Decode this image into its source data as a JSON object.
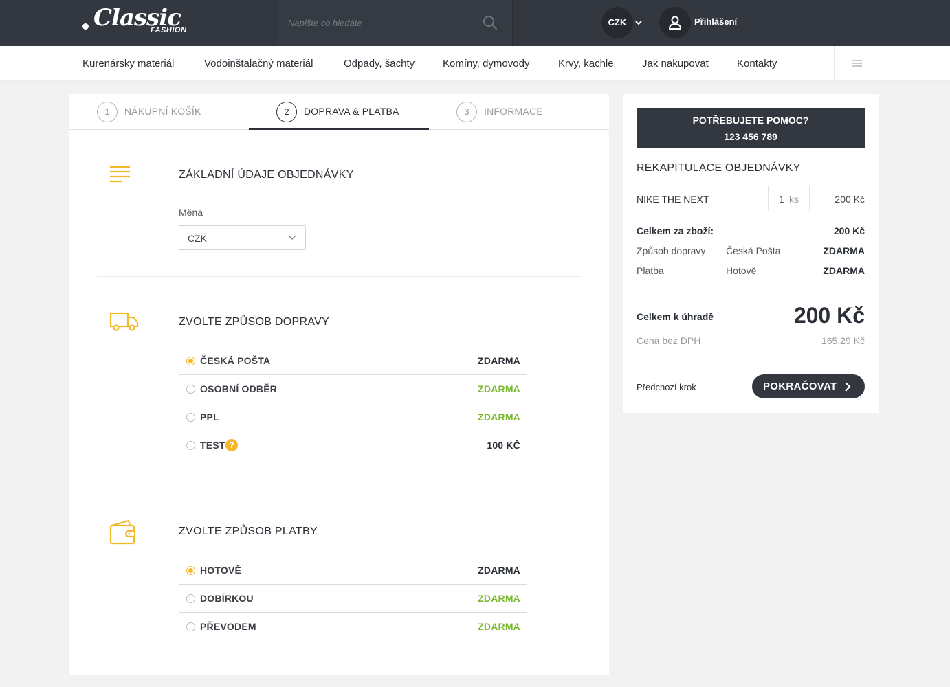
{
  "header": {
    "logo_script": "Classic",
    "logo_sub": "FASHION",
    "search_placeholder": "Napište co hledáte",
    "currency": "CZK",
    "login": "Přihlášení"
  },
  "nav": {
    "items": [
      "Kurenársky materiál",
      "Vodoinštalačný materiál",
      "Odpady, šachty",
      "Komíny, dymovody",
      "Krvy, kachle",
      "Jak nakupovat",
      "Kontakty"
    ]
  },
  "steps": [
    {
      "num": "1",
      "label": "NÁKUPNÍ KOŠÍK"
    },
    {
      "num": "2",
      "label": "DOPRAVA & PLATBA"
    },
    {
      "num": "3",
      "label": "INFORMACE"
    }
  ],
  "basic": {
    "title": "ZÁKLADNÍ ÚDAJE OBJEDNÁVKY",
    "currency_label": "Měna",
    "currency_value": "CZK"
  },
  "shipping": {
    "title": "ZVOLTE ZPŮSOB DOPRAVY",
    "options": [
      {
        "name": "ČESKÁ POŠTA",
        "price": "ZDARMA",
        "selected": true
      },
      {
        "name": "OSOBNÍ ODBĚR",
        "price": "ZDARMA",
        "selected": false
      },
      {
        "name": "PPL",
        "price": "ZDARMA",
        "selected": false
      },
      {
        "name": "TEST",
        "price": "100 KČ",
        "selected": false,
        "help": "?"
      }
    ]
  },
  "payment": {
    "title": "ZVOLTE ZPŮSOB PLATBY",
    "options": [
      {
        "name": "HOTOVĚ",
        "price": "ZDARMA",
        "selected": true
      },
      {
        "name": "DOBÍRKOU",
        "price": "ZDARMA",
        "selected": false
      },
      {
        "name": "PŘEVODEM",
        "price": "ZDARMA",
        "selected": false
      }
    ]
  },
  "sidebar": {
    "help_title": "POTŘEBUJETE POMOC?",
    "help_phone": "123 456 789",
    "recap_title": "REKAPITULACE OBJEDNÁVKY",
    "item": {
      "name": "NIKE THE NEXT",
      "qty": "1",
      "unit": "ks",
      "price": "200 Kč"
    },
    "goods_total_label": "Celkem za zboží:",
    "goods_total_value": "200 Kč",
    "shipping_label": "Způsob dopravy",
    "shipping_method": "Česká Pošta",
    "shipping_price": "ZDARMA",
    "payment_label": "Platba",
    "payment_method": "Hotově",
    "payment_price": "ZDARMA",
    "total_label": "Celkem k úhradě",
    "total_value": "200 Kč",
    "no_vat_label": "Cena bez DPH",
    "no_vat_value": "165,29 Kč",
    "prev_step": "Předchozí krok",
    "continue": "POKRAČOVAT"
  },
  "colors": {
    "dark": "#333840",
    "accent": "#f4b928",
    "green": "#7ab82c"
  }
}
